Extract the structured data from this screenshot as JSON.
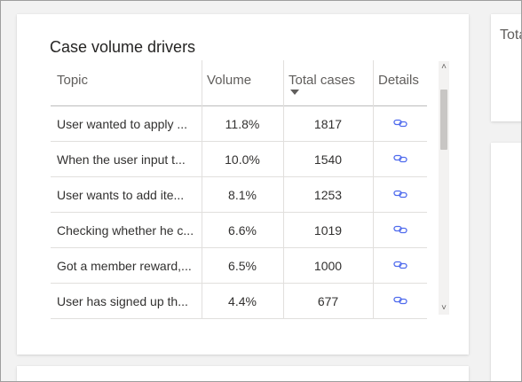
{
  "widget": {
    "title": "Case volume drivers",
    "columns": {
      "topic": "Topic",
      "volume": "Volume",
      "total_cases": "Total cases",
      "details": "Details"
    },
    "sorted_column": "total_cases",
    "sort_direction": "descending",
    "rows": [
      {
        "topic": "User wanted to apply ...",
        "volume": "11.8%",
        "total_cases": "1817",
        "details_icon": "link-icon"
      },
      {
        "topic": "When the user input t...",
        "volume": "10.0%",
        "total_cases": "1540",
        "details_icon": "link-icon"
      },
      {
        "topic": "User wants to add ite...",
        "volume": "8.1%",
        "total_cases": "1253",
        "details_icon": "link-icon"
      },
      {
        "topic": "Checking whether he c...",
        "volume": "6.6%",
        "total_cases": "1019",
        "details_icon": "link-icon"
      },
      {
        "topic": "Got a member reward,...",
        "volume": "6.5%",
        "total_cases": "1000",
        "details_icon": "link-icon"
      },
      {
        "topic": "User has signed up th...",
        "volume": "4.4%",
        "total_cases": "677",
        "details_icon": "link-icon"
      }
    ],
    "scrollbar": {
      "up_glyph": "˄",
      "down_glyph": "˅"
    }
  },
  "right_panel": {
    "title": "Tota"
  },
  "colors": {
    "link_icon": "#4f6bed",
    "background": "#f2f2f2",
    "card": "#ffffff"
  }
}
